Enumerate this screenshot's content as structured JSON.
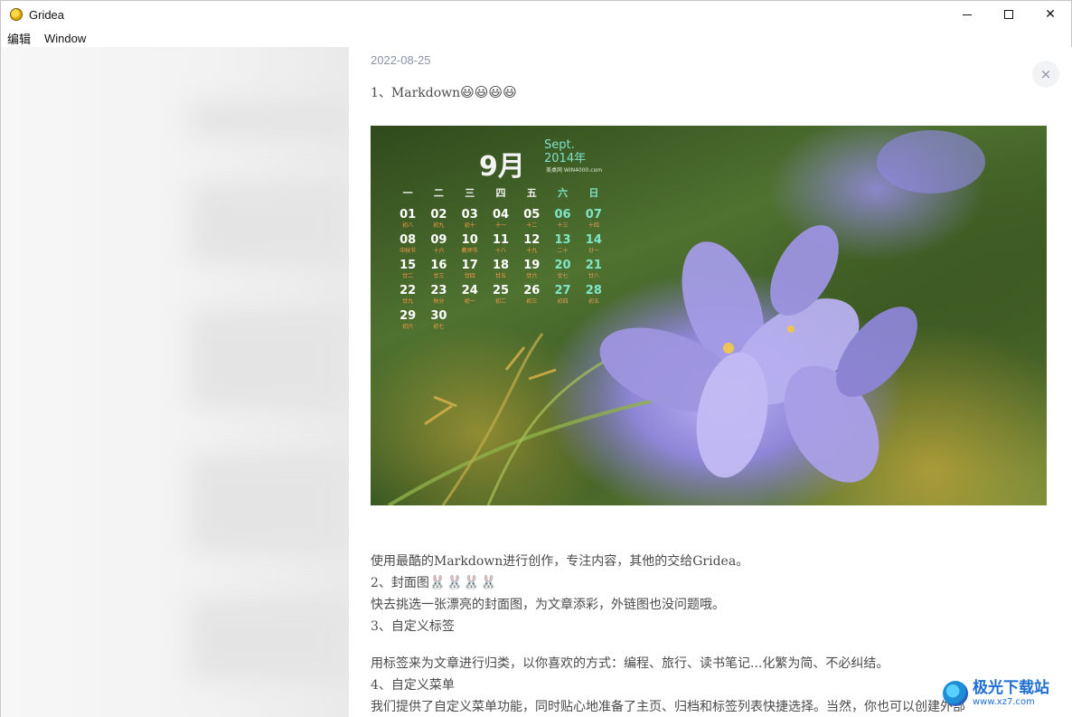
{
  "window": {
    "title": "Gridea",
    "minimize_glyph": "",
    "close_glyph": "✕"
  },
  "menu": {
    "items": [
      "编辑",
      "Window"
    ]
  },
  "article": {
    "date": "2022-08-25",
    "close_glyph": "×",
    "heading1": "1、Markdown",
    "heading1_emoji": "😃😃😃😃",
    "cover": {
      "calendar_month": "9月",
      "calendar_month_en": "Sept.",
      "calendar_year": "2014年",
      "calendar_site": "美桌网 WIN4000.com",
      "weekdays": [
        "一",
        "二",
        "三",
        "四",
        "五",
        "六",
        "日"
      ],
      "rows": [
        [
          [
            "01",
            "初八"
          ],
          [
            "02",
            "初九"
          ],
          [
            "03",
            "初十"
          ],
          [
            "04",
            "十一"
          ],
          [
            "05",
            "十二"
          ],
          [
            "06",
            "十三"
          ],
          [
            "07",
            "十四"
          ]
        ],
        [
          [
            "08",
            "中秋节"
          ],
          [
            "09",
            "十六"
          ],
          [
            "10",
            "教师节"
          ],
          [
            "11",
            "十八"
          ],
          [
            "12",
            "十九"
          ],
          [
            "13",
            "二十"
          ],
          [
            "14",
            "廿一"
          ]
        ],
        [
          [
            "15",
            "廿二"
          ],
          [
            "16",
            "廿三"
          ],
          [
            "17",
            "廿四"
          ],
          [
            "18",
            "廿五"
          ],
          [
            "19",
            "廿六"
          ],
          [
            "20",
            "廿七"
          ],
          [
            "21",
            "廿八"
          ]
        ],
        [
          [
            "22",
            "廿九"
          ],
          [
            "23",
            "秋分"
          ],
          [
            "24",
            "初一"
          ],
          [
            "25",
            "初二"
          ],
          [
            "26",
            "初三"
          ],
          [
            "27",
            "初四"
          ],
          [
            "28",
            "初五"
          ]
        ],
        [
          [
            "29",
            "初六"
          ],
          [
            "30",
            "初七"
          ],
          [
            "",
            ""
          ],
          [
            "",
            ""
          ],
          [
            "",
            ""
          ],
          [
            "",
            ""
          ],
          [
            "",
            ""
          ]
        ]
      ]
    },
    "para1": "使用最酷的Markdown进行创作，专注内容，其他的交给Gridea。",
    "heading2": "2、封面图",
    "heading2_emoji": "🐰🐰🐰🐰",
    "para2": "快去挑选一张漂亮的封面图，为文章添彩，外链图也没问题哦。",
    "heading3": "3、自定义标签",
    "para3": "用标签来为文章进行归类，以你喜欢的方式：编程、旅行、读书笔记...化繁为简、不必纠结。",
    "heading4": "4、自定义菜单",
    "para4": "我们提供了自定义菜单功能，同时贴心地准备了主页、归档和标签列表快捷选择。当然，你也可以创建外部"
  },
  "watermark": {
    "name": "极光下载站",
    "url": "www.xz7.com"
  }
}
